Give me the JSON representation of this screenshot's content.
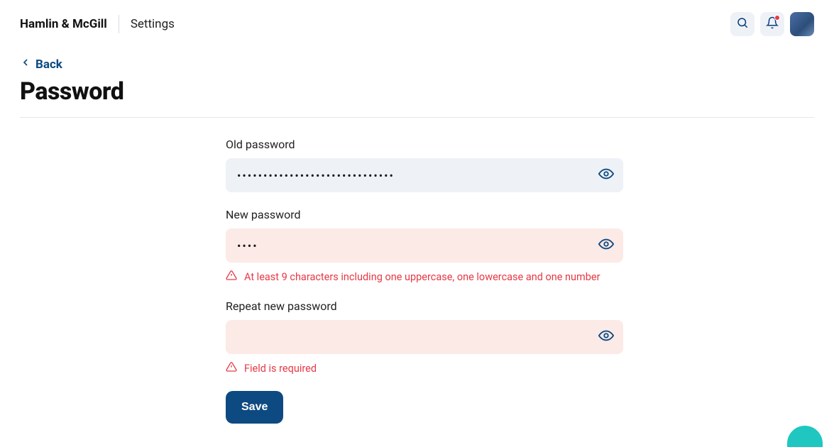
{
  "header": {
    "brand": "Hamlin & McGill",
    "section": "Settings"
  },
  "nav": {
    "back_label": "Back"
  },
  "page": {
    "title": "Password"
  },
  "form": {
    "old_password": {
      "label": "Old password",
      "value": "••••••••••••••••••••••••••••••"
    },
    "new_password": {
      "label": "New password",
      "value": "••••",
      "error": "At least 9 characters including one uppercase, one lowercase and one number"
    },
    "repeat_password": {
      "label": "Repeat new password",
      "value": "",
      "error": "Field is required"
    },
    "save_label": "Save"
  }
}
